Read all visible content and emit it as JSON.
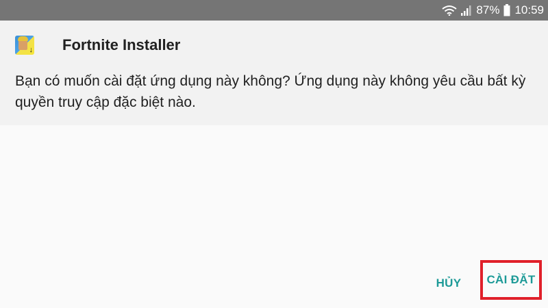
{
  "status_bar": {
    "battery_percent": "87%",
    "time": "10:59",
    "icons": [
      "wifi-icon",
      "signal-icon",
      "battery-icon"
    ],
    "background": "#757575"
  },
  "dialog": {
    "app_name": "Fortnite Installer",
    "app_icon": "fortnite-app-icon",
    "message": "Bạn có muốn cài đặt ứng dụng này không? Ứng dụng này không yêu cầu bất kỳ quyền truy cập đặc biệt nào.",
    "header_background": "#f2f2f2"
  },
  "buttons": {
    "cancel_label": "HỦY",
    "install_label": "CÀI ĐẶT",
    "accent_color": "#1d9a97",
    "highlight_color": "#e0202a"
  }
}
